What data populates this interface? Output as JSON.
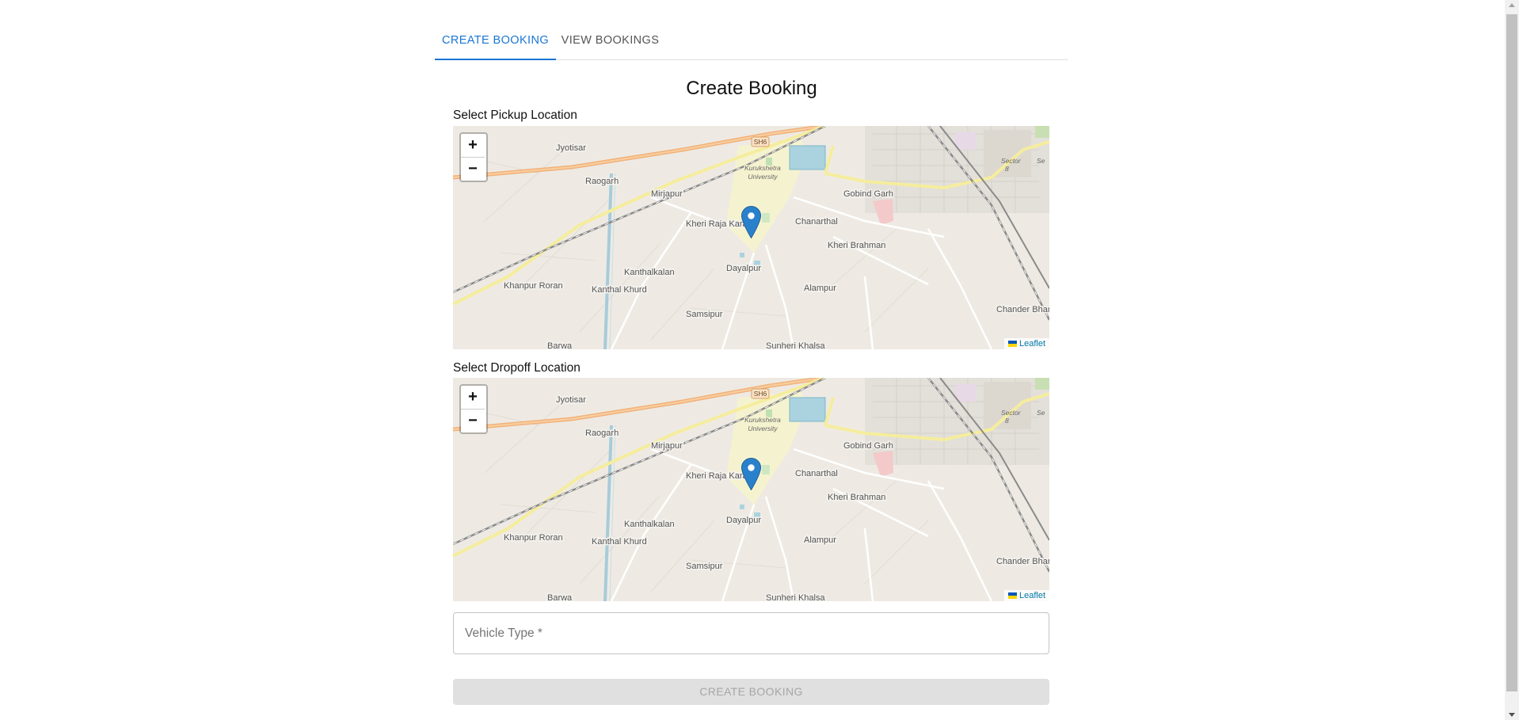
{
  "tabs": [
    {
      "label": "CREATE BOOKING",
      "active": true
    },
    {
      "label": "VIEW BOOKINGS",
      "active": false
    }
  ],
  "page_title": "Create Booking",
  "pickup": {
    "label": "Select Pickup Location",
    "zoom_in": "+",
    "zoom_out": "−",
    "attribution": "Leaflet"
  },
  "dropoff": {
    "label": "Select Dropoff Location",
    "zoom_in": "+",
    "zoom_out": "−",
    "attribution": "Leaflet"
  },
  "map_labels": {
    "sh6": "SH6",
    "univ1": "Kurukshetra",
    "univ2": "University",
    "jyotisar": "Jyotisar",
    "raogarh": "Raogarh",
    "mirjapur": "Mirjapur",
    "kheri_raja": "Kheri Raja Karan",
    "chanarthal": "Chanarthal",
    "gobind": "Gobind Garh",
    "kheri_brahman": "Kheri Brahman",
    "kanthalkalan": "Kanthalkalan",
    "dayalpur": "Dayalpur",
    "khanpur": "Khanpur Roran",
    "kanthal_khurd": "Kanthal Khurd",
    "alampur": "Alampur",
    "samsipur": "Samsipur",
    "chander": "Chander Bhan",
    "barwa": "Barwa",
    "sunheri": "Sunheri Khalsa",
    "sector": "Sector",
    "sector_num": "8",
    "se": "Se"
  },
  "vehicle_type": {
    "placeholder": "Vehicle Type *"
  },
  "submit_label": "CREATE BOOKING",
  "colors": {
    "accent": "#1976d2",
    "marker": "#2a81cb"
  },
  "icons": [
    "zoom-in-icon",
    "zoom-out-icon",
    "map-marker-icon",
    "ukraine-flag-icon"
  ]
}
